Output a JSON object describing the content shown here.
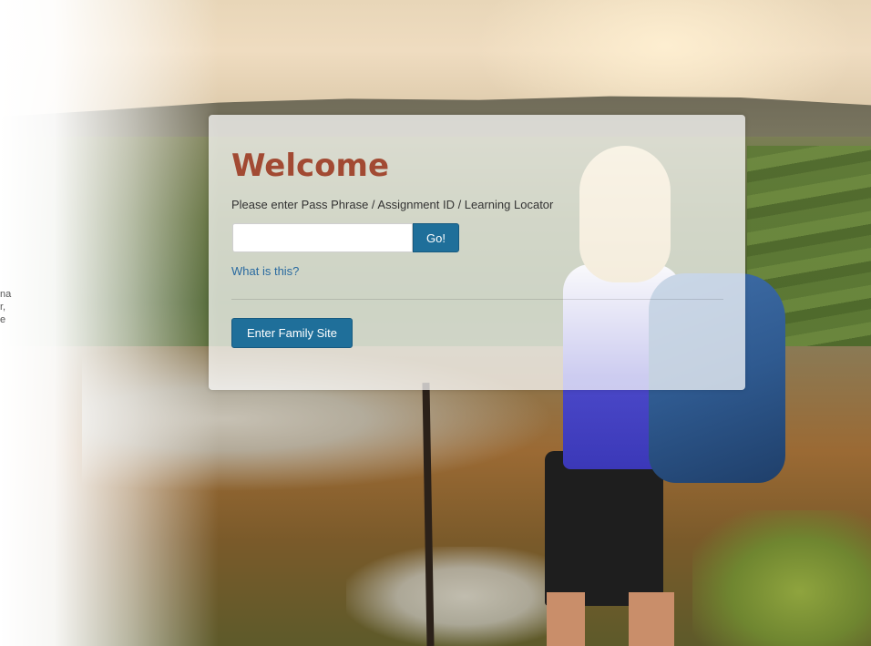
{
  "page": {
    "left_text_lines": [
      "na",
      "r,",
      "e"
    ]
  },
  "card": {
    "title": "Welcome",
    "prompt": "Please enter Pass Phrase / Assignment ID / Learning Locator",
    "input_value": "",
    "go_label": "Go!",
    "help_link": "What is this?",
    "family_button_label": "Enter Family Site"
  },
  "colors": {
    "title": "#a24a33",
    "button": "#1f6f9a",
    "link": "#2a6aa0"
  }
}
